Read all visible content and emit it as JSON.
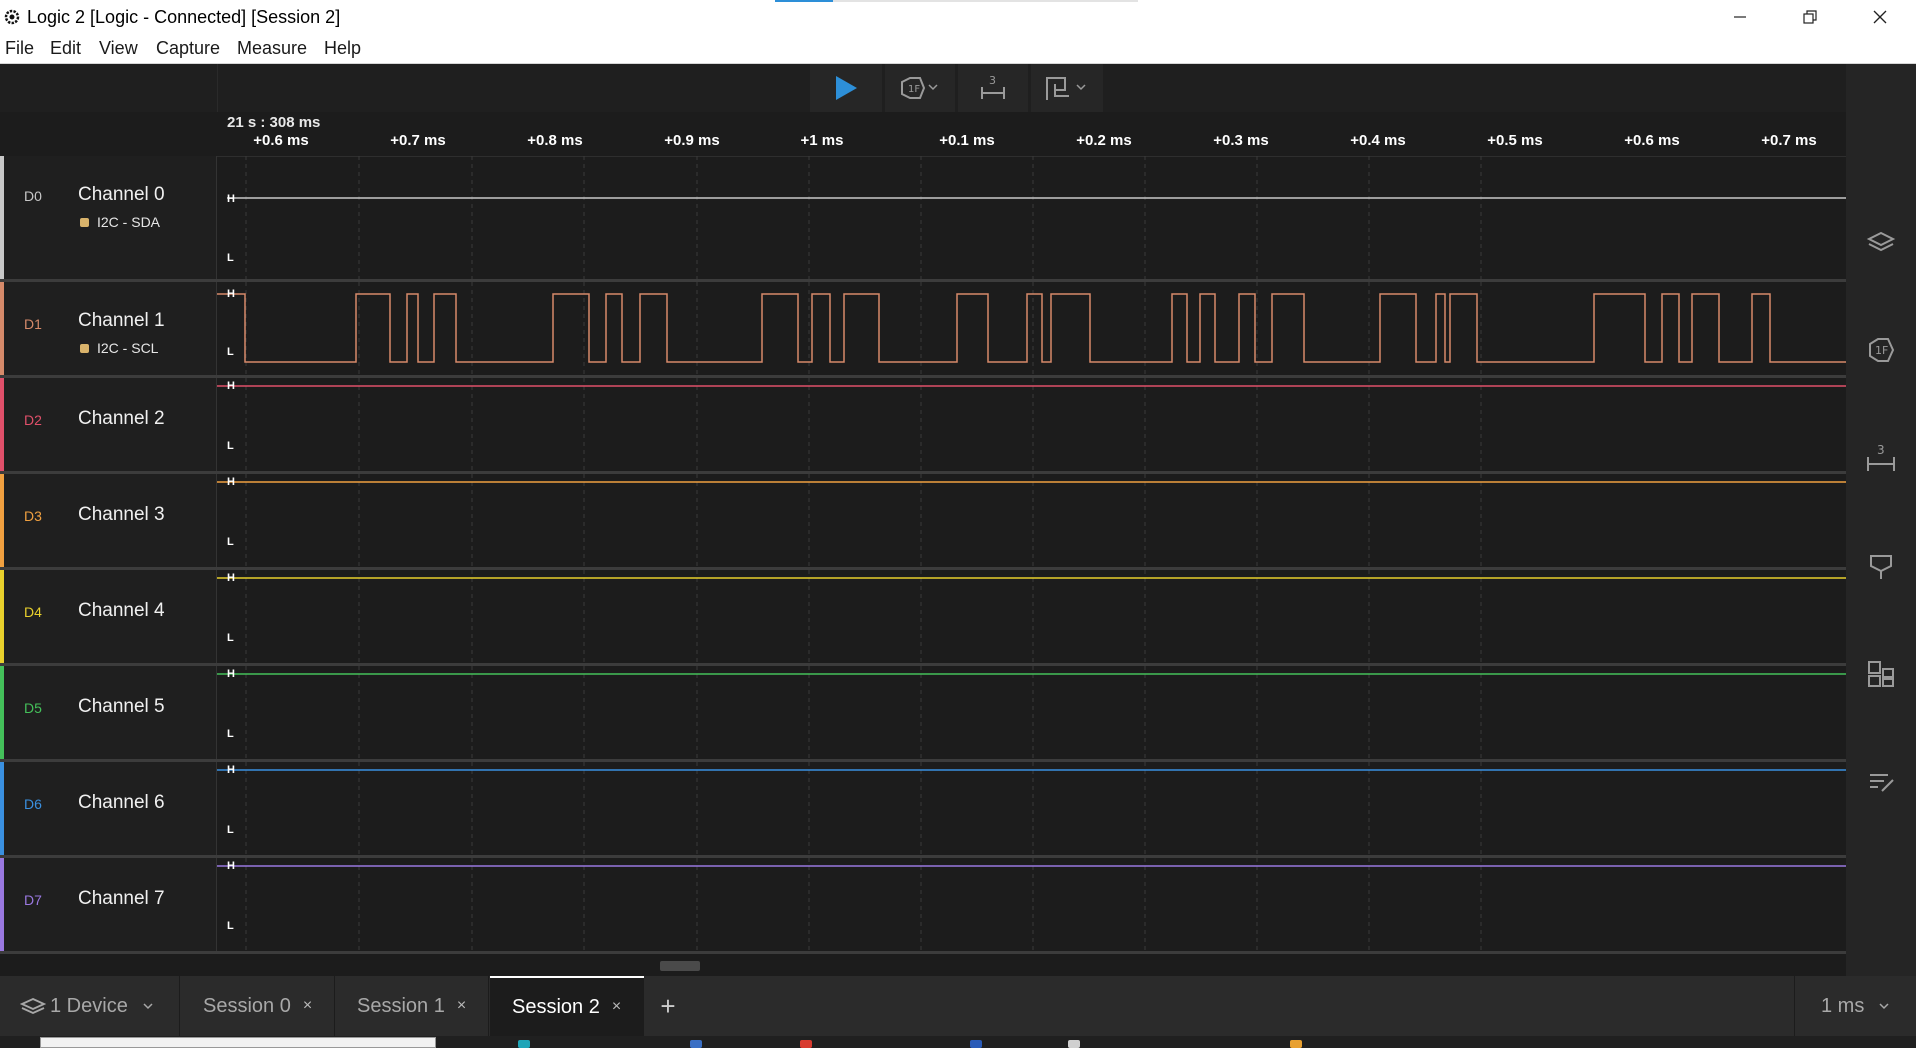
{
  "window": {
    "title": "Logic 2 [Logic - Connected] [Session 2]",
    "progress_fraction": 0.16,
    "icons": {
      "app": "gear-logo-icon",
      "minimize": "minimize-icon",
      "restore": "restore-icon",
      "close": "close-icon"
    }
  },
  "menu": [
    "File",
    "Edit",
    "View",
    "Capture",
    "Measure",
    "Help"
  ],
  "toolbar": {
    "play_icon": "play-icon",
    "trigger_icon": "trigger-icon",
    "measure_icon": "measure-icon",
    "annotation_icon": "annotation-icon",
    "accent_color": "#2d8fd8"
  },
  "timeline": {
    "absolute_time": "21 s : 308 ms",
    "ticks": [
      "+0.6 ms",
      "+0.7 ms",
      "+0.8 ms",
      "+0.9 ms",
      "+1 ms",
      "+0.1 ms",
      "+0.2 ms",
      "+0.3 ms",
      "+0.4 ms",
      "+0.5 ms",
      "+0.6 ms",
      "+0.7 ms"
    ]
  },
  "channels": [
    {
      "id": "D0",
      "name": "Channel 0",
      "analyzer": "I2C - SDA",
      "color": "#c8c8c8",
      "high": "H",
      "low": "L"
    },
    {
      "id": "D1",
      "name": "Channel 1",
      "analyzer": "I2C - SCL",
      "color": "#d68a6a",
      "high": "H",
      "low": "L"
    },
    {
      "id": "D2",
      "name": "Channel 2",
      "analyzer": "",
      "color": "#e0506a",
      "high": "H",
      "low": "L"
    },
    {
      "id": "D3",
      "name": "Channel 3",
      "analyzer": "",
      "color": "#f0a040",
      "high": "H",
      "low": "L"
    },
    {
      "id": "D4",
      "name": "Channel 4",
      "analyzer": "",
      "color": "#e8d02c",
      "high": "H",
      "low": "L"
    },
    {
      "id": "D5",
      "name": "Channel 5",
      "analyzer": "",
      "color": "#44c05a",
      "high": "H",
      "low": "L"
    },
    {
      "id": "D6",
      "name": "Channel 6",
      "analyzer": "",
      "color": "#3a90e0",
      "high": "H",
      "low": "L"
    },
    {
      "id": "D7",
      "name": "Channel 7",
      "analyzer": "",
      "color": "#9a78e0",
      "high": "H",
      "low": "L"
    }
  ],
  "sidebar_icons": [
    "analyzers-icon",
    "trigger-settings-icon",
    "timing-markers-icon",
    "annotations-icon",
    "extensions-icon",
    "notes-icon"
  ],
  "bottom": {
    "device_label": "1 Device",
    "device_icon": "device-icon",
    "tabs": [
      {
        "label": "Session 0",
        "close": "×"
      },
      {
        "label": "Session 1",
        "close": "×"
      },
      {
        "label": "Session 2",
        "close": "×"
      }
    ],
    "add_tab": "+",
    "timescale": "1 ms"
  }
}
